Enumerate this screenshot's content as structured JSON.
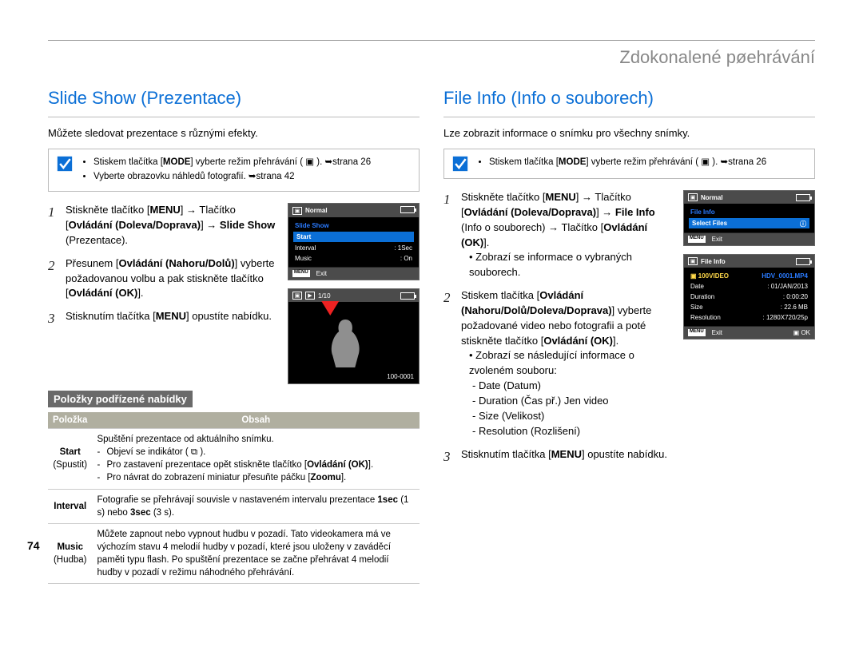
{
  "chapter_title": "Zdokonalené pøehrávání",
  "page_number": "74",
  "left": {
    "section_title": "Slide Show (Prezentace)",
    "intro": "Můžete sledovat prezentace s různými efekty.",
    "note": {
      "items": [
        "Stiskem tlačítka [MODE] vyberte režim přehrávání ( ▣ ). ➥strana 26",
        "Vyberte obrazovku náhledů fotografií. ➥strana 42"
      ]
    },
    "steps": [
      {
        "n": "1",
        "html": "Stiskněte tlačítko [<b>MENU</b>] → Tlačítko [<b>Ovládání (Doleva/Doprava)</b>] → <b>Slide Show</b> (Prezentace)."
      },
      {
        "n": "2",
        "html": "Přesunem [<b>Ovládání (Nahoru/Dolů)</b>] vyberte požadovanou volbu a pak stiskněte tlačítko [<b>Ovládání (OK)</b>]."
      },
      {
        "n": "3",
        "html": "Stisknutím tlačítka [<b>MENU</b>] opustíte nabídku."
      }
    ],
    "submenu_title": "Položky podřízené nabídky",
    "table": {
      "head": {
        "c1": "Položka",
        "c2": "Obsah"
      },
      "rows": [
        {
          "name": "Start",
          "sub": "(Spustit)",
          "desc_lead": "Spuštění prezentace od aktuálního snímku.",
          "bullets": [
            "Objeví se indikátor ( ⧉ ).",
            "Pro zastavení prezentace opět stiskněte tlačítko [<b>Ovládání (OK)</b>].",
            "Pro návrat do zobrazení miniatur přesuňte páčku [<b>Zoomu</b>]."
          ]
        },
        {
          "name": "Interval",
          "sub": "",
          "desc": "Fotografie se přehrávají souvisle v nastaveném intervalu prezentace <b>1sec</b> (1 s) nebo <b>3sec</b> (3 s)."
        },
        {
          "name": "Music",
          "sub": "(Hudba)",
          "desc": "Můžete zapnout nebo vypnout hudbu v pozadí. Tato videokamera má ve výchozím stavu 4 melodií hudby v pozadí, které jsou uloženy v zaváděcí paměti typu flash. Po spuštění prezentace se začne přehrávat 4 melodií hudby v pozadí v režimu náhodného přehrávání."
        }
      ]
    },
    "cam_menu": {
      "title": "Normal",
      "items": [
        {
          "label": "Slide Show",
          "hl": false,
          "blue": true
        },
        {
          "label": "Start",
          "hl": true
        },
        {
          "label": "Interval",
          "val": ": 1Sec"
        },
        {
          "label": "Music",
          "val": ": On"
        }
      ],
      "exit": "Exit"
    },
    "cam_preview": {
      "count": "1/10",
      "file": "100-0001"
    }
  },
  "right": {
    "section_title": "File Info (Info o souborech)",
    "intro": "Lze zobrazit informace o snímku pro všechny snímky.",
    "note": {
      "items": [
        "Stiskem tlačítka [MODE] vyberte režim přehrávání ( ▣ ). ➥strana 26"
      ]
    },
    "steps": [
      {
        "n": "1",
        "html": "Stiskněte tlačítko [<b>MENU</b>] → Tlačítko [<b>Ovládání (Doleva/Doprava)</b>] → <b>File Info</b> (Info o souborech) → Tlačítko [<b>Ovládání (OK)</b>].",
        "sub": "Zobrazí se informace o vybraných souborech."
      },
      {
        "n": "2",
        "html": "Stiskem tlačítka [<b>Ovládání (Nahoru/Dolů/Doleva/Doprava)</b>] vyberte požadované video nebo fotografii a poté stiskněte tlačítko [<b>Ovládání (OK)</b>].",
        "sub": "Zobrazí se následující informace o zvoleném souboru:",
        "list": [
          "Date (Datum)",
          "Duration (Čas př.) Jen video",
          "Size (Velikost)",
          "Resolution (Rozlišení)"
        ]
      },
      {
        "n": "3",
        "html": "Stisknutím tlačítka [<b>MENU</b>] opustíte nabídku."
      }
    ],
    "cam_menu": {
      "title": "Normal",
      "items": [
        {
          "label": "File Info",
          "blue": true
        },
        {
          "label": "Select Files",
          "hl": true,
          "icon": "i"
        }
      ],
      "exit": "Exit"
    },
    "cam_info": {
      "title": "File Info",
      "folder": "100VIDEO",
      "file": "HDV_0001.MP4",
      "rows": [
        {
          "k": "Date",
          "v": ": 01/JAN/2013"
        },
        {
          "k": "Duration",
          "v": ": 0:00:20"
        },
        {
          "k": "Size",
          "v": ": 22.6 MB"
        },
        {
          "k": "Resolution",
          "v": ": 1280X720/25p"
        }
      ],
      "exit": "Exit",
      "ok": "OK"
    }
  }
}
